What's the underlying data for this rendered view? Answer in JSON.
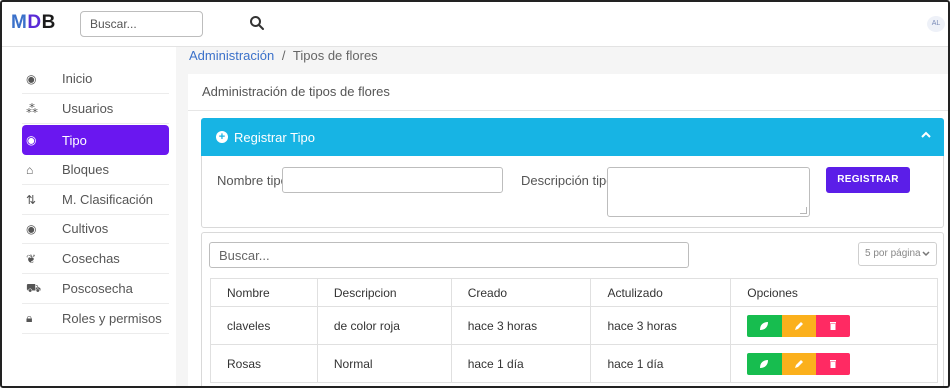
{
  "topbar": {
    "logo": {
      "m": "M",
      "d": "D",
      "b": "B"
    },
    "search_placeholder": "Buscar...",
    "avatar_initials": "AL"
  },
  "sidebar": {
    "items": [
      {
        "label": "Inicio",
        "icon": "gauge-icon",
        "active": false
      },
      {
        "label": "Usuarios",
        "icon": "users-icon",
        "active": false
      },
      {
        "label": "Tipo",
        "icon": "gauge-icon",
        "active": true
      },
      {
        "label": "Bloques",
        "icon": "home-icon",
        "active": false
      },
      {
        "label": "M. Clasificación",
        "icon": "sort-icon",
        "active": false
      },
      {
        "label": "Cultivos",
        "icon": "gauge-icon",
        "active": false
      },
      {
        "label": "Cosechas",
        "icon": "leaf-icon",
        "active": false
      },
      {
        "label": "Poscosecha",
        "icon": "tractor-icon",
        "active": false
      },
      {
        "label": "Roles y permisos",
        "icon": "lock-icon",
        "active": false
      }
    ]
  },
  "breadcrumb": {
    "parent": "Administración",
    "separator": "/",
    "current": "Tipos de flores"
  },
  "card": {
    "title": "Administración de tipos de flores"
  },
  "register": {
    "header": "Registrar Tipo",
    "nombre_label": "Nombre tipo",
    "nombre_value": "",
    "desc_label": "Descripción tipo",
    "desc_value": "",
    "button": "REGISTRAR"
  },
  "table": {
    "search_placeholder": "Buscar...",
    "per_page": "5 por página",
    "headers": [
      "Nombre",
      "Descripcion",
      "Creado",
      "Actulizado",
      "Opciones"
    ],
    "rows": [
      {
        "nombre": "claveles",
        "descripcion": "de color roja",
        "creado": "hace 3 horas",
        "actualizado": "hace 3 horas"
      },
      {
        "nombre": "Rosas",
        "descripcion": "Normal",
        "creado": "hace 1 día",
        "actualizado": "hace 1 día"
      }
    ]
  },
  "colors": {
    "accent": "#6a17f0",
    "header_blue": "#17b4e4",
    "button_purple": "#5b1ee8",
    "opt_green": "#17bd4f",
    "opt_yellow": "#fbb01c",
    "opt_red": "#ff2a63"
  }
}
